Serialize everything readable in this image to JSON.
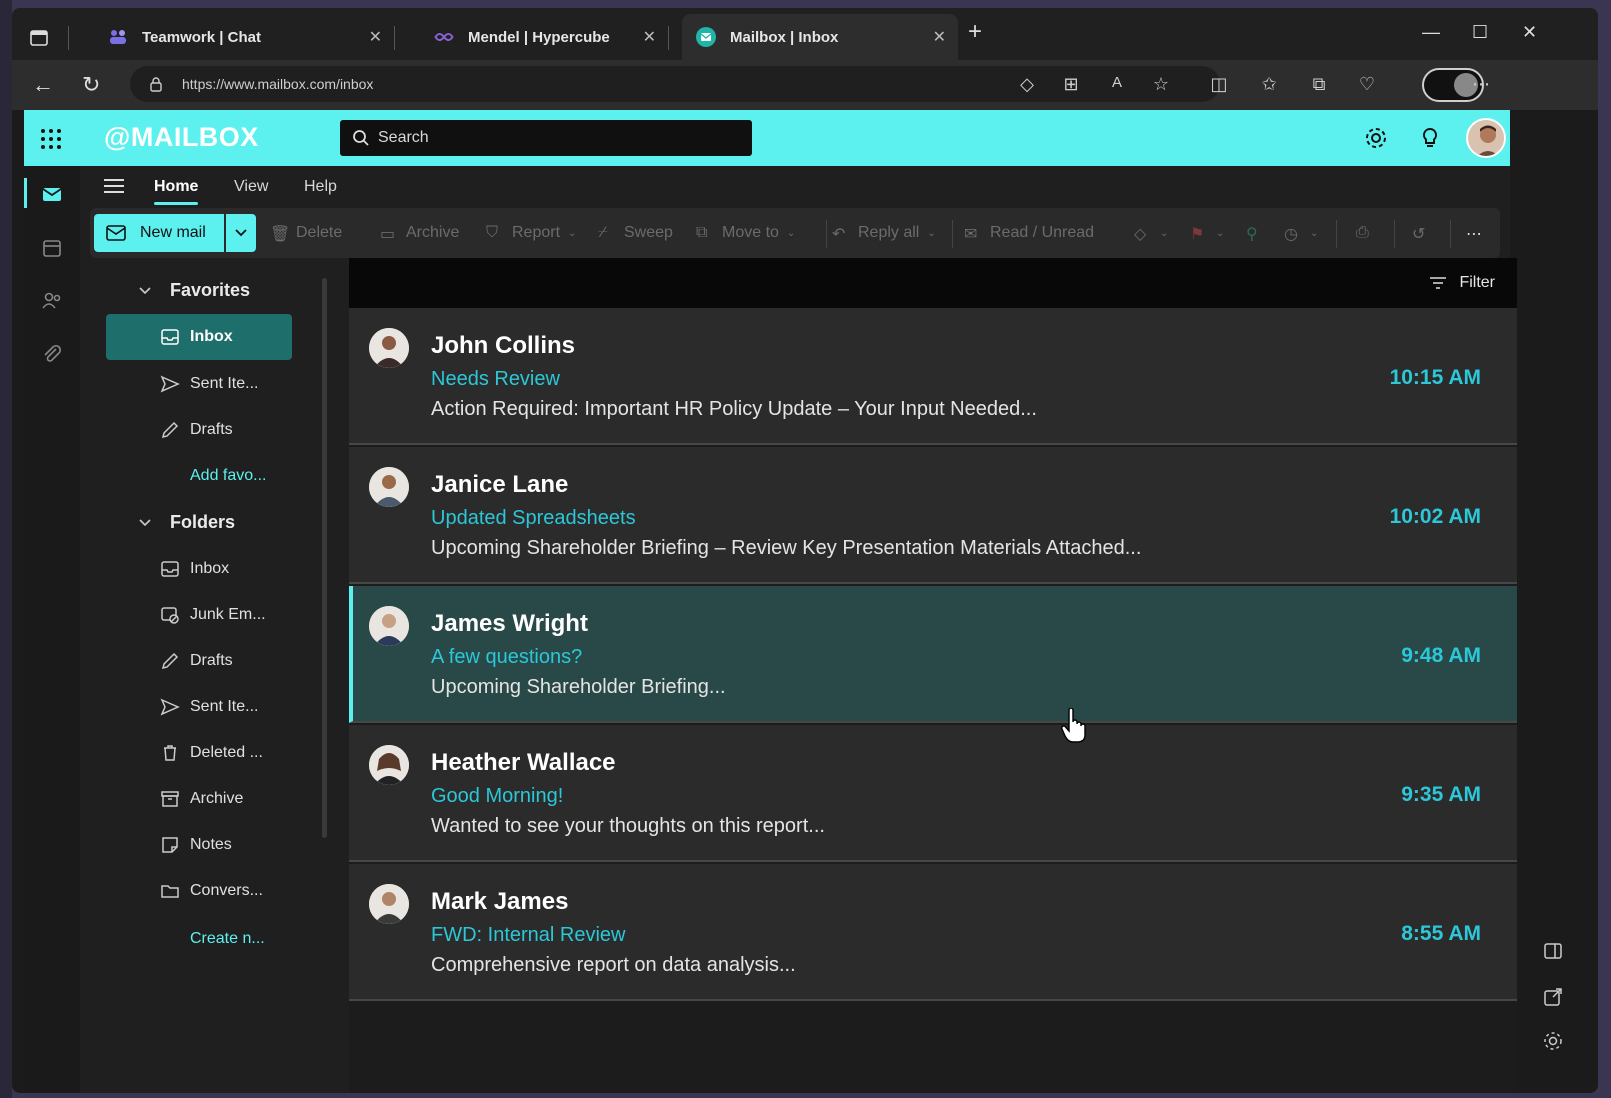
{
  "browser": {
    "tabs": [
      {
        "title": "Teamwork | Chat",
        "icon": "teamwork-icon",
        "color": "#7b6ee6"
      },
      {
        "title": "Mendel | Hypercube",
        "icon": "hypercube-icon",
        "color": "#8a63d2"
      },
      {
        "title": "Mailbox | Inbox",
        "icon": "mailbox-icon",
        "color": "#1fb5a9"
      }
    ],
    "url": "https://www.mailbox.com/inbox"
  },
  "app": {
    "brand": "@MAILBOX",
    "accent": "#5cf0ee",
    "search": {
      "placeholder": "Search"
    },
    "ribbon_tabs": [
      "Home",
      "View",
      "Help"
    ],
    "toolbar": {
      "new_mail": "New mail",
      "delete": "Delete",
      "archive": "Archive",
      "report": "Report",
      "sweep": "Sweep",
      "move_to": "Move to",
      "reply_all": "Reply all",
      "read_unread": "Read / Unread"
    },
    "favorites": {
      "title": "Favorites",
      "items": [
        "Inbox",
        "Sent Ite...",
        "Drafts"
      ],
      "add": "Add favo..."
    },
    "folders": {
      "title": "Folders",
      "items": [
        "Inbox",
        "Junk Em...",
        "Drafts",
        "Sent Ite...",
        "Deleted ...",
        "Archive",
        "Notes",
        "Convers..."
      ],
      "create": "Create n..."
    },
    "list": {
      "filter": "Filter",
      "messages": [
        {
          "sender": "John Collins",
          "subject": "Needs Review",
          "preview": "Action Required: Important HR Policy Update – Your Input Needed...",
          "time": "10:15 AM",
          "selected": false
        },
        {
          "sender": "Janice Lane",
          "subject": "Updated Spreadsheets",
          "preview": "Upcoming Shareholder Briefing – Review Key Presentation Materials Attached...",
          "time": "10:02 AM",
          "selected": false
        },
        {
          "sender": "James Wright",
          "subject": "A few questions?",
          "preview": "Upcoming Shareholder Briefing...",
          "time": "9:48 AM",
          "selected": true
        },
        {
          "sender": "Heather Wallace",
          "subject": "Good Morning!",
          "preview": "Wanted to see your thoughts on this report...",
          "time": "9:35 AM",
          "selected": false
        },
        {
          "sender": "Mark James",
          "subject": "FWD: Internal Review",
          "preview": "Comprehensive report on data analysis...",
          "time": "8:55 AM",
          "selected": false
        }
      ]
    }
  }
}
